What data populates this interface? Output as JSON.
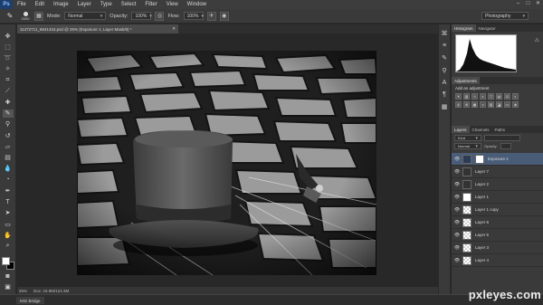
{
  "app": {
    "logo": "Ps",
    "menu": [
      "File",
      "Edit",
      "Image",
      "Layer",
      "Type",
      "Select",
      "Filter",
      "View",
      "Window"
    ],
    "window_controls": [
      "–",
      "□",
      "✕"
    ]
  },
  "options_bar": {
    "brush_size": "2000",
    "mode_label": "Mode:",
    "mode_value": "Normal",
    "opacity_label": "Opacity:",
    "opacity_value": "100%",
    "flow_label": "Flow:",
    "flow_value": "100%",
    "workspace": "Photography"
  },
  "document": {
    "tab_title": "11472711_6841434.psd @ 25% (Exposure 1, Layer Mask/8) *",
    "zoom": "25%",
    "doc_size": "Doc: 15.9M/124.3M"
  },
  "panels": {
    "histogram_tabs": [
      "Histogram",
      "Navigator"
    ],
    "adjustments_tab": "Adjustments",
    "adjustments_title": "Add an adjustment",
    "layer_tabs": [
      "Layers",
      "Channels",
      "Paths"
    ],
    "kind_label": "Kind",
    "blend_mode": "Normal",
    "opacity_label": "Opacity:",
    "lock_label": "Lock:",
    "fill_label": "Fill:"
  },
  "layers": [
    {
      "name": "Exposure 1",
      "thumb": "adj",
      "selected": true
    },
    {
      "name": "Layer 7",
      "thumb": "dark",
      "selected": false
    },
    {
      "name": "Layer 2",
      "thumb": "dark",
      "selected": false
    },
    {
      "name": "Layer 1",
      "thumb": "hat",
      "selected": false
    },
    {
      "name": "Layer 1 copy",
      "thumb": "checker",
      "selected": false
    },
    {
      "name": "Layer 6",
      "thumb": "checker",
      "selected": false
    },
    {
      "name": "Layer 5",
      "thumb": "checker",
      "selected": false
    },
    {
      "name": "Layer 3",
      "thumb": "checker",
      "selected": false
    },
    {
      "name": "Layer 4",
      "thumb": "checker",
      "selected": false
    }
  ],
  "bottom": {
    "mini_bridge": "Mini Bridge"
  },
  "watermark": "pxleyes.com"
}
